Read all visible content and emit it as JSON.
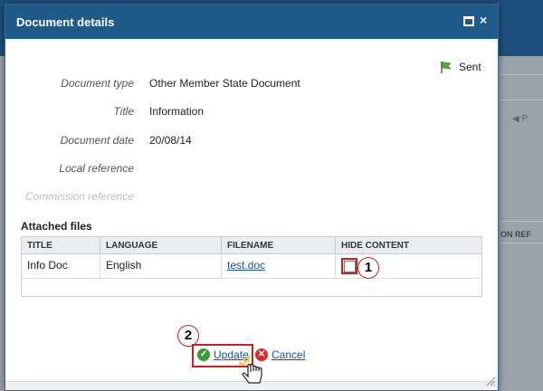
{
  "dialog": {
    "title": "Document details",
    "status": {
      "label": "Sent",
      "icon": "flag-icon"
    }
  },
  "fields": [
    {
      "label": "Document type",
      "value": "Other Member State Document"
    },
    {
      "label": "Title",
      "value": "Information"
    },
    {
      "label": "Document date",
      "value": "20/08/14"
    },
    {
      "label": "Local reference",
      "value": ""
    },
    {
      "label": "Commission reference",
      "value": ""
    }
  ],
  "attached_files": {
    "title": "Attached files",
    "columns": [
      "TITLE",
      "LANGUAGE",
      "FILENAME",
      "HIDE CONTENT"
    ],
    "rows": [
      {
        "title": "Info Doc",
        "language": "English",
        "filename": "test.doc",
        "hide_content": false
      }
    ]
  },
  "actions": {
    "update_label": "Update",
    "cancel_label": "Cancel"
  },
  "callouts": {
    "checkbox": "1",
    "update": "2"
  },
  "background": {
    "pager": "◀ P",
    "column_header": "ON REF"
  }
}
